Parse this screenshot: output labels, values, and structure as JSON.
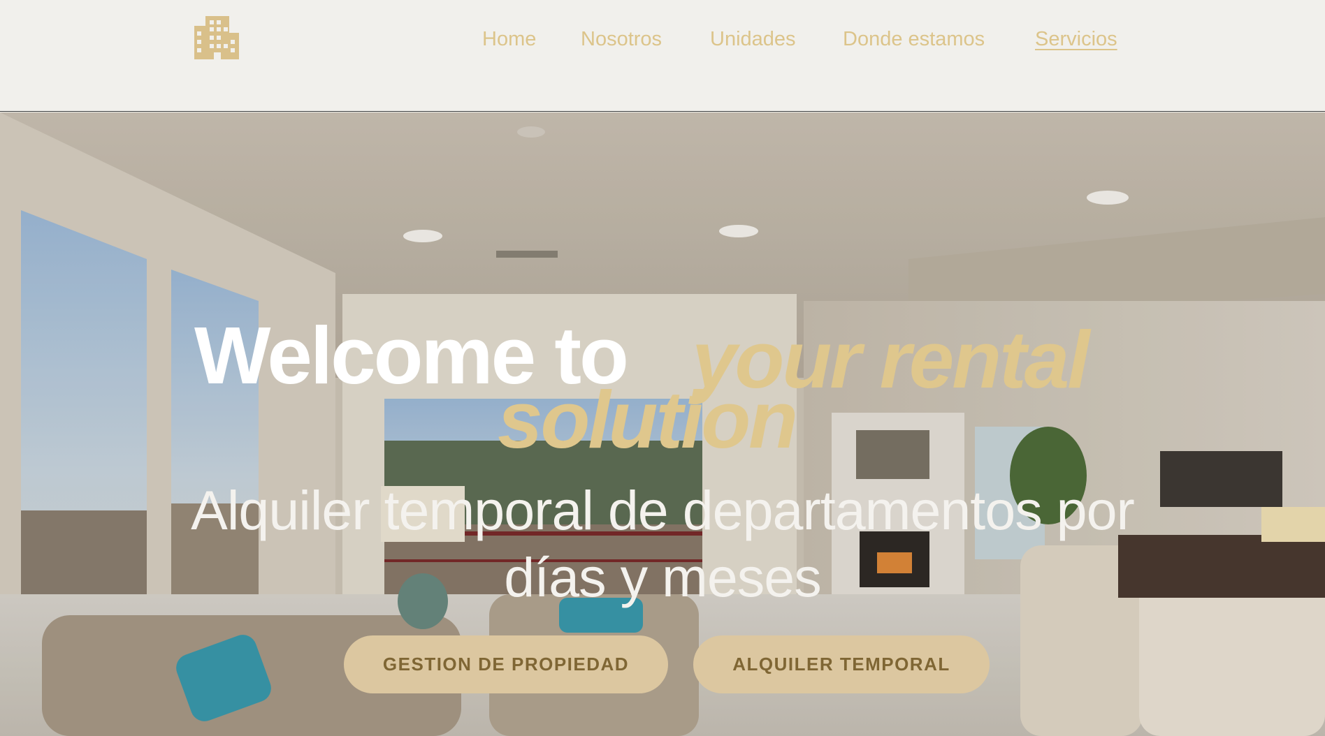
{
  "header": {
    "logo_icon": "building-icon",
    "nav": [
      {
        "label": "Home"
      },
      {
        "label": "Nosotros"
      },
      {
        "label": "Unidades"
      },
      {
        "label": "Donde estamos"
      },
      {
        "label": "Servicios",
        "active": true
      }
    ]
  },
  "hero": {
    "title_plain": "Welcome to",
    "title_accent_line1": "your rental",
    "title_accent_line2": "solution",
    "subtitle": "Alquiler temporal de departamentos por días y meses",
    "buttons": [
      {
        "label": "GESTION DE PROPIEDAD"
      },
      {
        "label": "ALQUILER TEMPORAL"
      }
    ]
  },
  "colors": {
    "accent_gold": "#dfc78d",
    "nav_text": "#dcc48a",
    "button_bg": "#dcc7a0",
    "button_text": "#7f6634",
    "header_bg": "#f1f0ec"
  }
}
